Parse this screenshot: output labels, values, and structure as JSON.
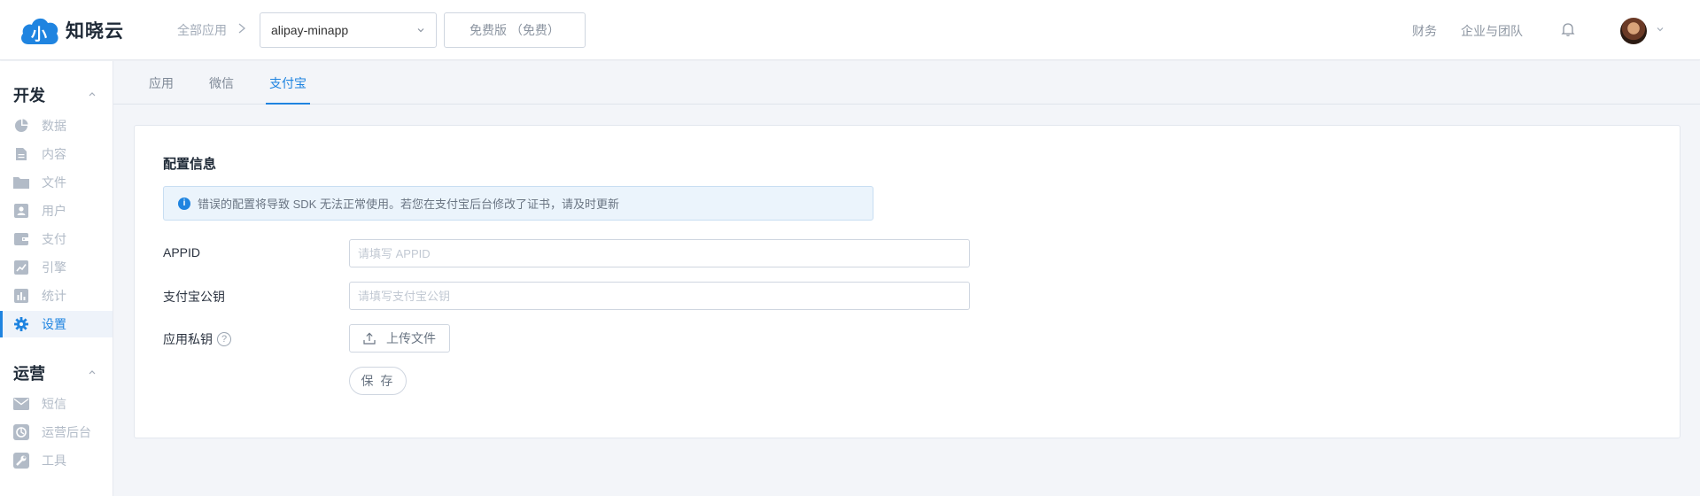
{
  "brand": {
    "name": "知晓云",
    "logo_glyph": "小",
    "accent": "#1f84e0"
  },
  "header": {
    "breadcrumb_all_apps": "全部应用",
    "app_select_value": "alipay-minapp",
    "plan_label": "免费版 （免费）",
    "links": {
      "finance": "财务",
      "org": "企业与团队"
    },
    "icons": {
      "notifications": "bell-icon",
      "user_menu": "chevron-down-icon"
    }
  },
  "sidebar": {
    "sections": [
      {
        "title": "开发",
        "items": [
          {
            "label": "数据",
            "icon": "pie-chart-icon",
            "active": false
          },
          {
            "label": "内容",
            "icon": "document-icon",
            "active": false
          },
          {
            "label": "文件",
            "icon": "folder-icon",
            "active": false
          },
          {
            "label": "用户",
            "icon": "user-card-icon",
            "active": false
          },
          {
            "label": "支付",
            "icon": "wallet-icon",
            "active": false
          },
          {
            "label": "引擎",
            "icon": "trend-chart-icon",
            "active": false
          },
          {
            "label": "统计",
            "icon": "bar-chart-icon",
            "active": false
          },
          {
            "label": "设置",
            "icon": "gear-icon",
            "active": true
          }
        ]
      },
      {
        "title": "运营",
        "items": [
          {
            "label": "短信",
            "icon": "mail-icon",
            "active": false
          },
          {
            "label": "运营后台",
            "icon": "dashboard-icon",
            "active": false
          },
          {
            "label": "工具",
            "icon": "wrench-icon",
            "active": false
          }
        ]
      }
    ]
  },
  "tabs": [
    {
      "label": "应用",
      "active": false
    },
    {
      "label": "微信",
      "active": false
    },
    {
      "label": "支付宝",
      "active": true
    }
  ],
  "config": {
    "title": "配置信息",
    "alert": "错误的配置将导致 SDK 无法正常使用。若您在支付宝后台修改了证书，请及时更新",
    "fields": {
      "appid": {
        "label": "APPID",
        "value": "",
        "placeholder": "请填写 APPID"
      },
      "public_key": {
        "label": "支付宝公钥",
        "value": "",
        "placeholder": "请填写支付宝公钥"
      },
      "private_key": {
        "label": "应用私钥",
        "help": "?"
      }
    },
    "upload_label": "上传文件",
    "save_label": "保 存"
  }
}
